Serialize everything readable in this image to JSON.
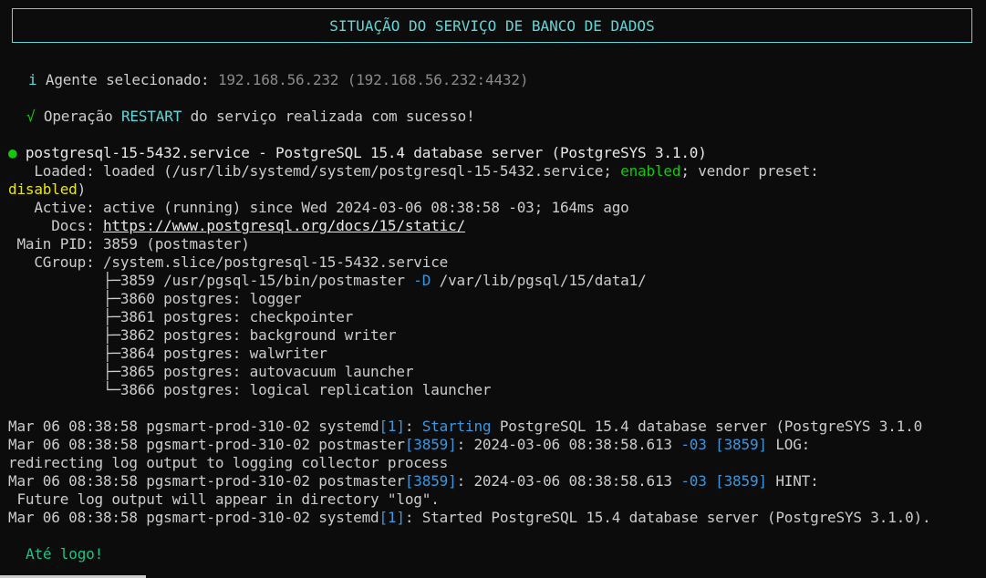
{
  "banner": {
    "title": "SITUAÇÃO DO SERVIÇO DE BANCO DE DADOS"
  },
  "info": {
    "icon": "i",
    "label": "Agente selecionado:",
    "agent": "192.168.56.232 (192.168.56.232:4432)"
  },
  "success": {
    "icon": "√",
    "prefix": "Operação",
    "action": "RESTART",
    "suffix": "do serviço realizada com sucesso!"
  },
  "service": {
    "bullet": "●",
    "header": "postgresql-15-5432.service - PostgreSQL 15.4 database server (PostgreSYS 3.1.0)",
    "loaded_label": "   Loaded:",
    "loaded_value": " loaded (/usr/lib/systemd/system/postgresql-15-5432.service;",
    "loaded_enabled": "enabled",
    "loaded_rest": "; vendor preset:",
    "loaded_disabled": "disabled",
    "loaded_close": ")",
    "active_label": "   Active:",
    "active_value": " active (running) since Wed 2024-03-06 08:38:58 -03; 164ms ago",
    "docs_label": "     Docs:",
    "docs_url": "https://www.postgresql.org/docs/15/static/",
    "pid_label": " Main PID:",
    "pid_value": " 3859 (postmaster)",
    "cgroup_label": "   CGroup:",
    "cgroup_value": " /system.slice/postgresql-15-5432.service",
    "proc_main_prefix": "           ├─3859 /usr/pgsql-15/bin/postmaster ",
    "proc_main_flag": "-D",
    "proc_main_path": " /var/lib/pgsql/15/data1/",
    "procs": [
      "           ├─3860 postgres: logger",
      "           ├─3861 postgres: checkpointer",
      "           ├─3862 postgres: background writer",
      "           ├─3864 postgres: walwriter",
      "           ├─3865 postgres: autovacuum launcher",
      "           └─3866 postgres: logical replication launcher"
    ]
  },
  "logs": {
    "l1_prefix": "Mar 06 08:38:58 pgsmart-prod-310-02 systemd",
    "l1_pid": "[1]",
    "l1_colon": ": ",
    "l1_starting": "Starting",
    "l1_rest": " PostgreSQL 15.4 database server (PostgreSYS 3.1.0",
    "l2_prefix": "Mar 06 08:38:58 pgsmart-prod-310-02 postmaster",
    "l2_pid": "[3859]",
    "l2_mid": ": 2024-03-06 08:38:58.613 ",
    "l2_tz": "-03",
    "l2_space": " ",
    "l2_pid2": "[3859]",
    "l2_tail": " LOG:",
    "l3": "redirecting log output to logging collector process",
    "l4_prefix": "Mar 06 08:38:58 pgsmart-prod-310-02 postmaster",
    "l4_pid": "[3859]",
    "l4_mid": ": 2024-03-06 08:38:58.613 ",
    "l4_tz": "-03",
    "l4_space": " ",
    "l4_pid2": "[3859]",
    "l4_tail": " HINT:",
    "l5": " Future log output will appear in directory \"log\".",
    "l6_prefix": "Mar 06 08:38:58 pgsmart-prod-310-02 systemd",
    "l6_pid": "[1]",
    "l6_rest": ": Started PostgreSQL 15.4 database server (PostgreSYS 3.1.0)."
  },
  "farewell": "Até logo!",
  "colors": {
    "background": "#0c0c0c",
    "accent_cyan": "#61d6d6",
    "success_green": "#16c60c",
    "warning_yellow": "#e5e510"
  }
}
